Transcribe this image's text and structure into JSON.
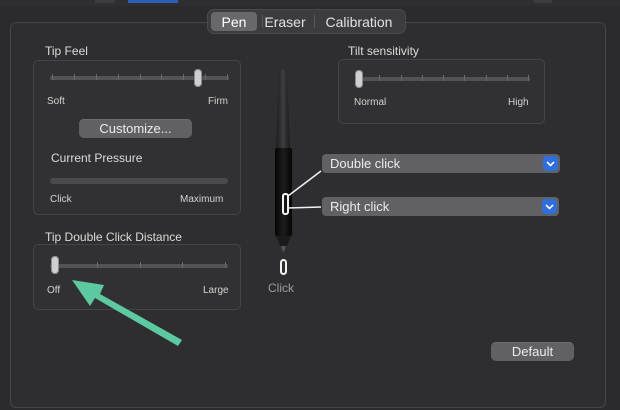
{
  "tabs": [
    {
      "label": "Pen",
      "active": true
    },
    {
      "label": "Eraser",
      "active": false
    },
    {
      "label": "Calibration",
      "active": false
    }
  ],
  "tip_feel": {
    "title": "Tip Feel",
    "min_label": "Soft",
    "max_label": "Firm",
    "level": 0.83,
    "customize_label": "Customize...",
    "pressure_title": "Current Pressure",
    "pressure_min_label": "Click",
    "pressure_max_label": "Maximum",
    "pressure_level": 0
  },
  "tilt": {
    "title": "Tilt sensitivity",
    "min_label": "Normal",
    "max_label": "High",
    "level": 0
  },
  "double_click": {
    "title": "Tip Double Click Distance",
    "min_label": "Off",
    "max_label": "Large",
    "level": 0
  },
  "pen_buttons": {
    "upper_button": "Double click",
    "lower_button": "Right click",
    "tip_label": "Click"
  },
  "default_label": "Default",
  "colors": {
    "accent": "#2f6fdc",
    "annotation_arrow": "#5cc9a0"
  }
}
